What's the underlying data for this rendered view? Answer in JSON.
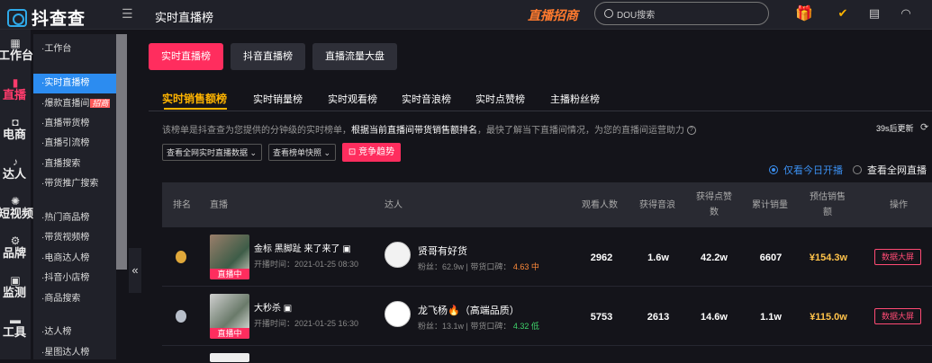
{
  "header": {
    "logo_text": "抖查查",
    "breadcrumb": "实时直播榜",
    "promo": "直播招商",
    "search_placeholder": "DOU搜索"
  },
  "sidebar": [
    {
      "icon": "grid-icon",
      "label": "工作台"
    },
    {
      "icon": "chart-bars-icon",
      "label": "直播",
      "active": true
    },
    {
      "icon": "bag-icon",
      "label": "电商"
    },
    {
      "icon": "douyin-icon",
      "label": "达人"
    },
    {
      "icon": "video-icon",
      "label": "短视频"
    },
    {
      "icon": "brand-icon",
      "label": "品牌"
    },
    {
      "icon": "monitor-icon",
      "label": "监测"
    },
    {
      "icon": "toolbox-icon",
      "label": "工具"
    }
  ],
  "subnav": {
    "group1": [
      "·工作台"
    ],
    "group2": [
      "·实时直播榜",
      "·爆款直播间",
      "·直播带货榜",
      "·直播引流榜",
      "·直播搜索",
      "·带货推广搜索"
    ],
    "hot_badge": "招商",
    "group3": [
      "·热门商品榜",
      "·带货视频榜",
      "·电商达人榜",
      "·抖音小店榜",
      "·商品搜索"
    ],
    "group4": [
      "·达人榜",
      "·星图达人榜"
    ]
  },
  "main_tabs": [
    "实时直播榜",
    "抖音直播榜",
    "直播流量大盘"
  ],
  "sub_tabs": [
    "实时销售额榜",
    "实时销量榜",
    "实时观看榜",
    "实时音浪榜",
    "实时点赞榜",
    "主播粉丝榜"
  ],
  "description": {
    "prefix": "该榜单是抖查查为您提供的分钟级的实时榜单，",
    "bold": "根据当前直播间带货销售额排名",
    "suffix": "，最快了解当下直播间情况，为您的直播间运营助力",
    "help_icon": "question-icon"
  },
  "refresh": "39s后更新",
  "filters": {
    "dd1": "查看全网实时直播数据",
    "dd2": "查看榜单快照",
    "trend": "竞争趋势"
  },
  "radios": [
    {
      "label": "仅看今日开播",
      "checked": true
    },
    {
      "label": "查看全网直播",
      "checked": false
    }
  ],
  "table": {
    "headers": {
      "rank": "排名",
      "live": "直播",
      "kol": "达人",
      "viewers": "观看人数",
      "yinlang": "获得音浪",
      "likes_1": "获得点赞",
      "likes_2": "数",
      "sales": "累计销量",
      "est_1": "预估销售",
      "est_2": "额",
      "action": "操作"
    },
    "rows": [
      {
        "title": "金标 黑脚趾 来了来了",
        "time": "开播时间：2021-01-25 08:30",
        "live_tag": "直播中",
        "kol_name": "贤哥有好货",
        "fans": "粉丝：62.9w",
        "score_label": "带货口碑：",
        "score": "4.63 中",
        "viewers": "2962",
        "yinlang": "1.6w",
        "likes": "42.2w",
        "sales": "6607",
        "est": "¥154.3w",
        "action": "数据大屏"
      },
      {
        "title": "大秒杀",
        "time": "开播时间：2021-01-25 16:30",
        "live_tag": "直播中",
        "kol_name": "龙飞杨🔥（高端品质）",
        "fans": "粉丝：13.1w",
        "score_label": "带货口碑：",
        "score": "4.32 低",
        "viewers": "5753",
        "yinlang": "2613",
        "likes": "14.6w",
        "sales": "1.1w",
        "est": "¥115.0w",
        "action": "数据大屏"
      }
    ]
  },
  "colors": {
    "accent": "#ff2d5e",
    "gold": "#ffb400",
    "blue": "#2c8cf0"
  }
}
